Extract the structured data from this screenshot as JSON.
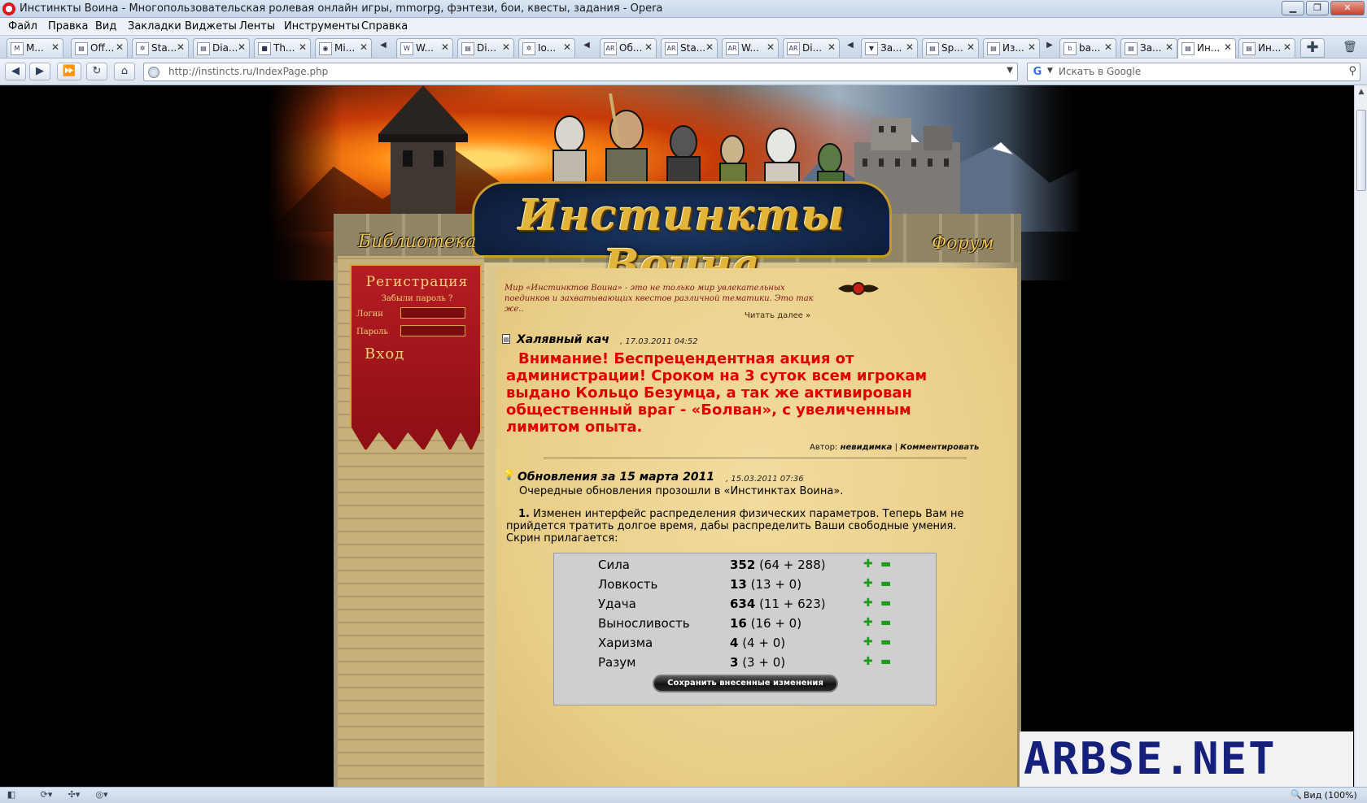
{
  "window": {
    "title": "Инстинкты Воина - Многопользовательская ролевая онлайн игры, mmorpg, фэнтези, бои, квесты, задания - Opera",
    "buttons": [
      "▁",
      "❐",
      "✕"
    ]
  },
  "menu": [
    "Файл",
    "Правка",
    "Вид",
    "Закладки",
    "Виджеты",
    "Ленты",
    "Инструменты",
    "Справка"
  ],
  "tabs": [
    {
      "label": "M...",
      "icon": "M"
    },
    {
      "label": "Off...",
      "icon": "▤"
    },
    {
      "label": "Sta...",
      "icon": "✲"
    },
    {
      "label": "Dia...",
      "icon": "▤"
    },
    {
      "label": "Th...",
      "icon": "■"
    },
    {
      "label": "Mi...",
      "icon": "◉"
    },
    {
      "label": "W...",
      "icon": "W"
    },
    {
      "label": "Di...",
      "icon": "▤"
    },
    {
      "label": "Io...",
      "icon": "✲"
    },
    {
      "label": "Об...",
      "icon": "AR"
    },
    {
      "label": "Sta...",
      "icon": "AR"
    },
    {
      "label": "W...",
      "icon": "AR"
    },
    {
      "label": "Di...",
      "icon": "AR"
    },
    {
      "label": "За...",
      "icon": "▼"
    },
    {
      "label": "Sp...",
      "icon": "▤"
    },
    {
      "label": "Из...",
      "icon": "▤"
    },
    {
      "label": "ba...",
      "icon": "b"
    },
    {
      "label": "За...",
      "icon": "▤"
    },
    {
      "label": "Ин...",
      "icon": "▤",
      "active": true
    },
    {
      "label": "Ин...",
      "icon": "▤"
    }
  ],
  "address": {
    "url": "http://instincts.ru/IndexPage.php",
    "search_placeholder": "Искать в Google"
  },
  "site": {
    "logo_text": "Инстинкты Воина",
    "nav_library": "Библиотека",
    "nav_forum": "Форум"
  },
  "login": {
    "title": "Регистрация",
    "forgot": "Забыли пароль ?",
    "login_label": "Логин",
    "password_label": "Пароль",
    "submit": "Вход"
  },
  "intro": {
    "text": "Мир «Инстинктов Воина» - это не только мир увлекательных поединков и захватывающих квестов различной тематики. Это так же..",
    "read_more": "Читать далее »"
  },
  "news": [
    {
      "title": "Халявный кач",
      "date": ", 17.03.2011 04:52",
      "body": "Внимание! Беспрецендентная акция от администрации! Сроком на 3 суток всем игрокам выдано Кольцо Безумца, а так же активирован общественный враг - «Болван», с увеличенным лимитом опыта.",
      "author_prefix": "Автор:",
      "author": "невидимка",
      "sep": "|",
      "comment": "Комментировать"
    },
    {
      "title": "Обновления за 15 марта 2011",
      "date": ", 15.03.2011 07:36",
      "p1": "Очередные обновления прозошли в «Инстинктах Воина».",
      "p2_num": "1.",
      "p2": " Изменен интерфейс распределения физических параметров. Теперь Вам не прийдется тратить долгое время, дабы распределить Ваши свободные умения. Скрин прилагается:"
    }
  ],
  "stats": [
    {
      "name": "Сила",
      "value": "352",
      "detail": " (64 + 288)"
    },
    {
      "name": "Ловкость",
      "value": "13",
      "detail": " (13 + 0)"
    },
    {
      "name": "Удача",
      "value": "634",
      "detail": " (11 + 623)"
    },
    {
      "name": "Выносливость",
      "value": "16",
      "detail": " (16 + 0)"
    },
    {
      "name": "Харизма",
      "value": "4",
      "detail": " (4 + 0)"
    },
    {
      "name": "Разум",
      "value": "3",
      "detail": " (3 + 0)"
    }
  ],
  "stats_save": "Сохранить внесенные изменения",
  "watermark": "ARBSE.NET",
  "status": {
    "zoom": "Вид (100%)"
  }
}
